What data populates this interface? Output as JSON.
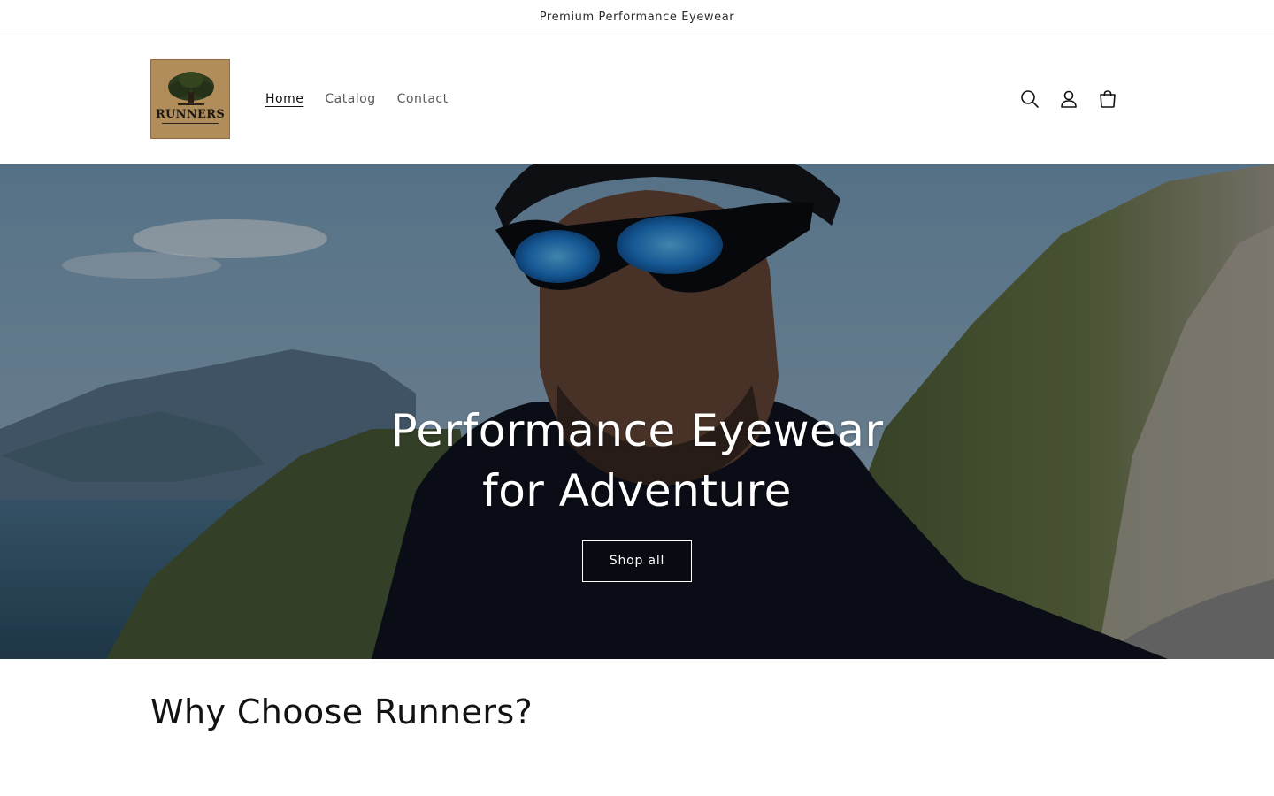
{
  "announcement": {
    "text": "Premium Performance Eyewear"
  },
  "logo": {
    "wordmark": "RUNNERS"
  },
  "nav": {
    "items": [
      {
        "label": "Home",
        "active": true
      },
      {
        "label": "Catalog",
        "active": false
      },
      {
        "label": "Contact",
        "active": false
      }
    ]
  },
  "header_icons": [
    "search-icon",
    "account-icon",
    "cart-icon"
  ],
  "hero": {
    "title": "Performance Eyewear for Adventure",
    "button_label": "Shop all"
  },
  "section": {
    "heading": "Why Choose Runners?"
  },
  "colors": {
    "text": "#121212",
    "muted": "#5a5a5a",
    "logo_bg": "#b08d5a",
    "lens_blue": "#1f7fd6"
  }
}
